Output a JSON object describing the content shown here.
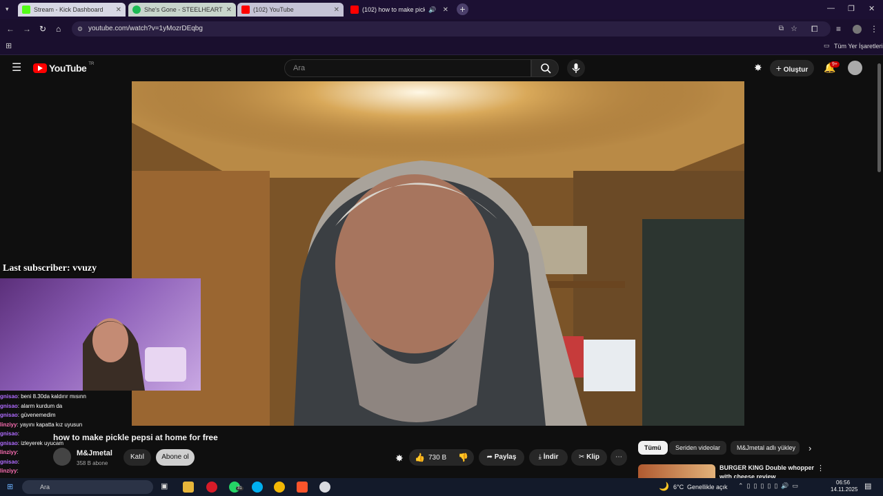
{
  "browser": {
    "tabs": [
      {
        "label": "Stream - Kick Dashboard",
        "favicon_color": "#53fc18"
      },
      {
        "label": "She's Gone - STEELHEART",
        "favicon_color": "#1db954"
      },
      {
        "label": "(102) YouTube",
        "favicon_color": "#ff0000"
      },
      {
        "label": "(102) how to make pickle p",
        "favicon_color": "#ff0000"
      }
    ],
    "url": "youtube.com/watch?v=1yMozrDEqbg",
    "bookmarks_label": "Tüm Yer İşaretleri"
  },
  "youtube": {
    "logo_text": "YouTube",
    "logo_region": "TR",
    "search_placeholder": "Ara",
    "create_label": "Oluştur",
    "notifications_badge": "9+",
    "accent": "#ff0000"
  },
  "stream_overlay": {
    "last_subscriber": "Last subscriber: vvuzy",
    "chat": [
      {
        "user": "gnisao",
        "text": ": beni 8.30da kaldırır mısınn",
        "color": "#b06bff"
      },
      {
        "user": "gnisao",
        "text": ": alarm kurdum da",
        "color": "#b06bff"
      },
      {
        "user": "gnisao",
        "text": ": güvenemedim",
        "color": "#b06bff"
      },
      {
        "user": "linziyy",
        "text": ": yayını kapatta kız uyusun",
        "color": "#ff6fb5"
      },
      {
        "user": "gnisao",
        "text": ":",
        "color": "#b06bff"
      },
      {
        "user": "gnisao",
        "text": ": izleyerek uyucam",
        "color": "#b06bff"
      },
      {
        "user": "linziyy",
        "text": ":",
        "color": "#ff6fb5"
      },
      {
        "user": "gnisao",
        "text": ":",
        "color": "#b06bff"
      },
      {
        "user": "linziyy",
        "text": ":",
        "color": "#ff6fb5"
      },
      {
        "user": "gnisao",
        "text": ": ikisi de lavuk",
        "color": "#b06bff"
      },
      {
        "user": "BotRix",
        "text": ": !komuts",
        "color": "#53fc18"
      }
    ]
  },
  "video": {
    "title": "how to make pickle pepsi at home for",
    "title_emphasis": "free",
    "channel": "M&Jmetal",
    "subscribers": "358 B abone",
    "join_label": "Katıl",
    "subscribe_label": "Abone ol",
    "likes": "730 B",
    "share_label": "Paylaş",
    "download_label": "İndir",
    "clip_label": "Klip"
  },
  "sidebar": {
    "chips": [
      "Tümü",
      "Seriden videolar",
      "M&Jmetal adlı yükley"
    ],
    "recommendation": {
      "title": "BURGER KING Double whopper",
      "subtitle": "with cheese review"
    }
  },
  "taskbar": {
    "search_label": "Ara",
    "weather": "6°C",
    "weather_desc": "Genellikle açık",
    "time": "06:56",
    "date": "14.11.2025",
    "whatsapp_badge": "31"
  }
}
